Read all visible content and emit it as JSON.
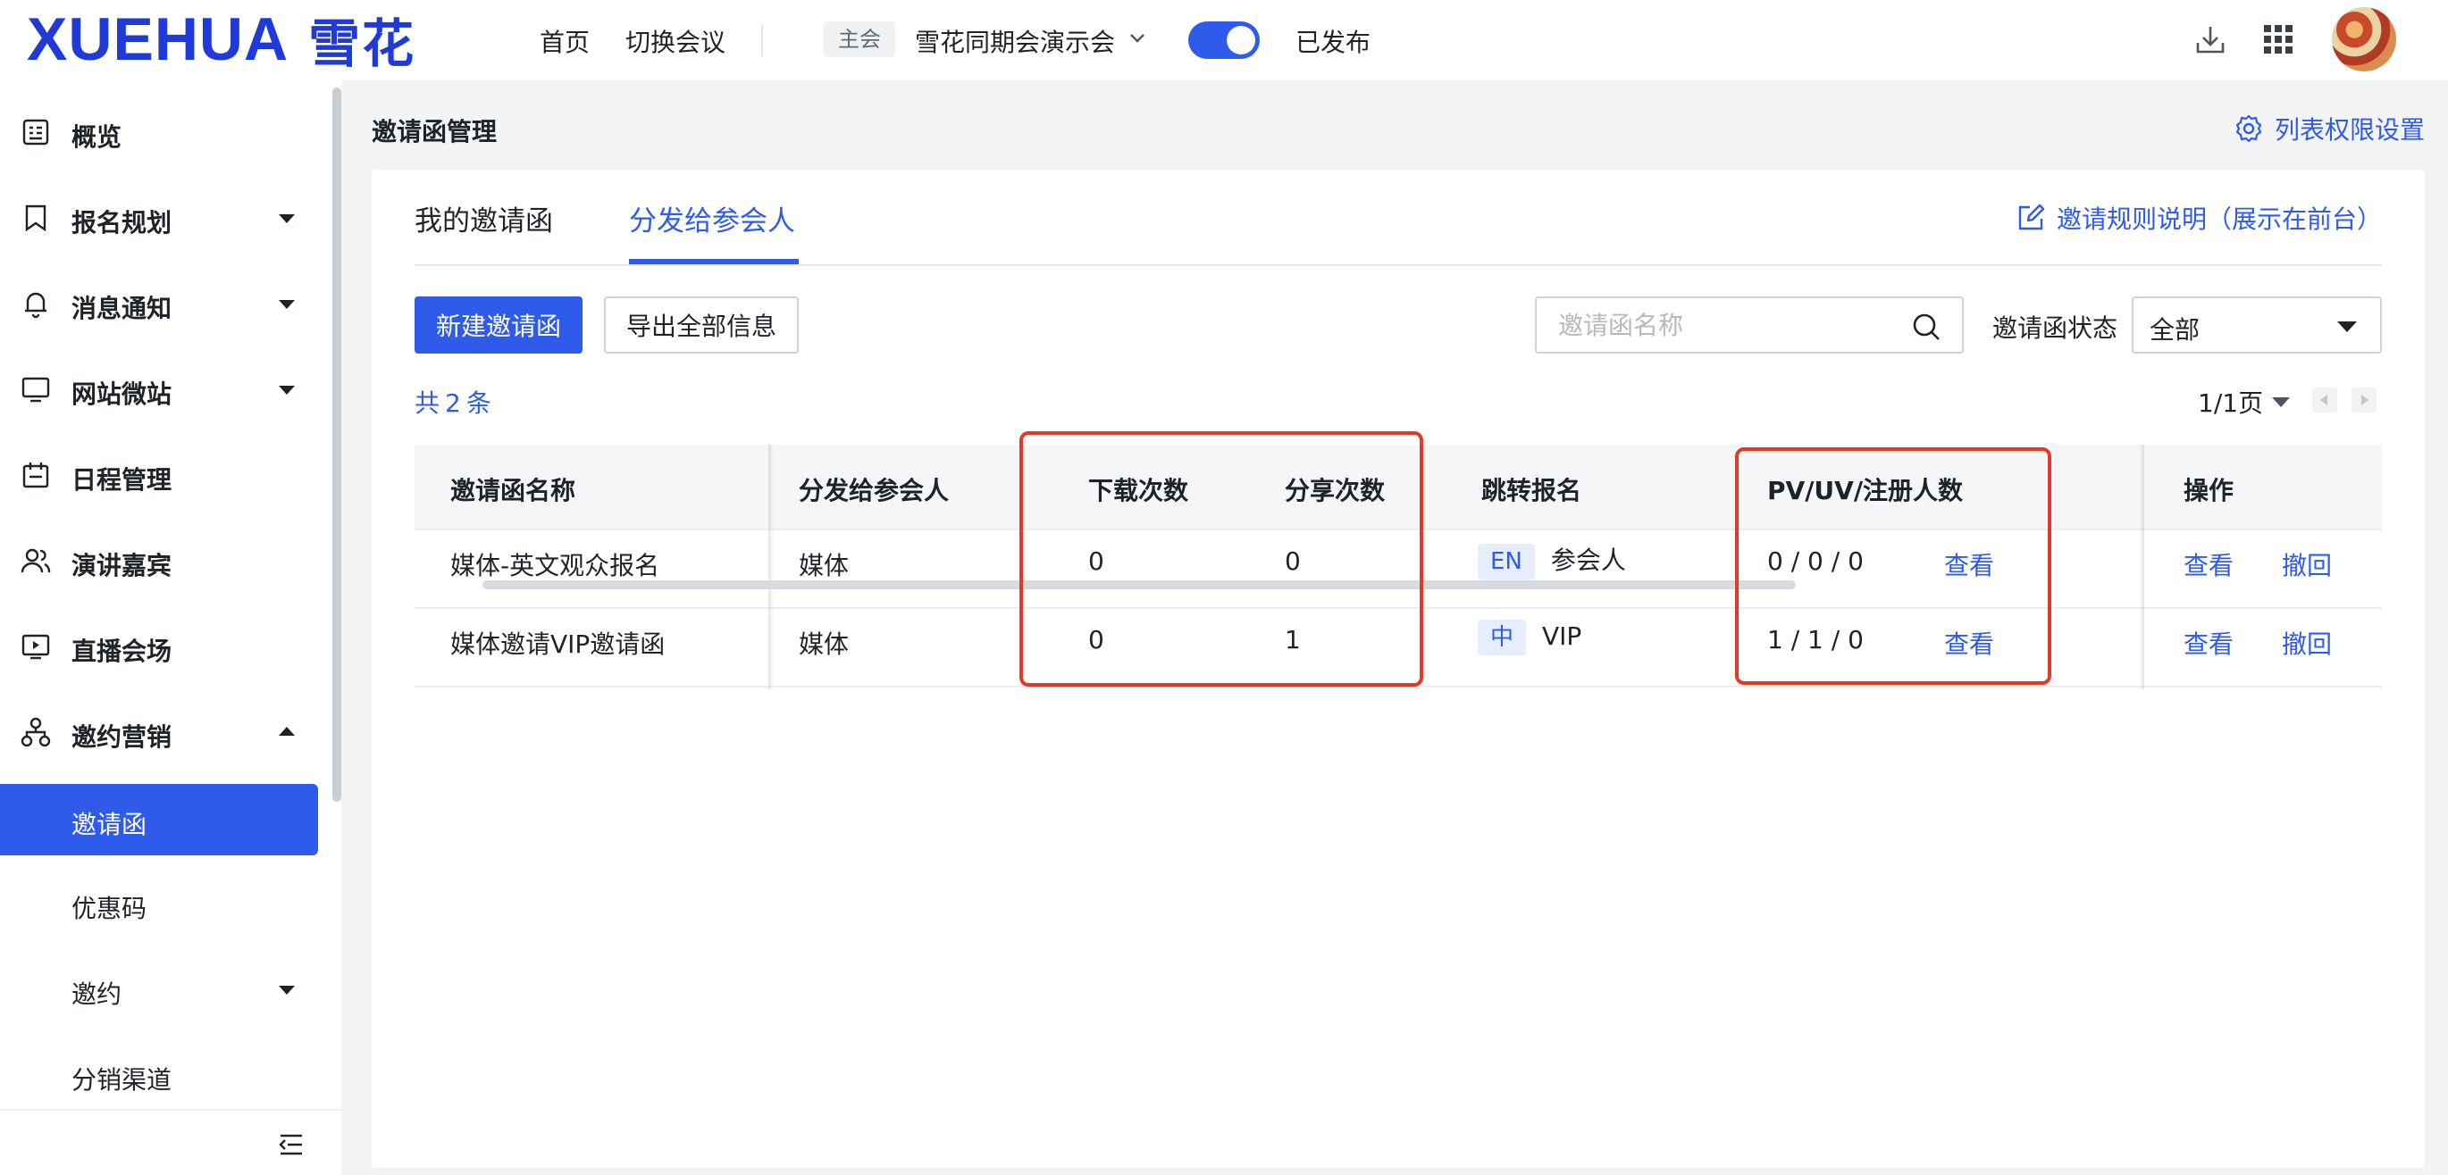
{
  "header": {
    "logo_en": "XUEHUA",
    "logo_cn": "雪花",
    "nav_home": "首页",
    "nav_switch": "切换会议",
    "main_tag": "主会",
    "event_name": "雪花同期会演示会",
    "toggle_on": true,
    "publish_status": "已发布"
  },
  "sidebar": {
    "items": [
      {
        "label": "概览",
        "icon": "overview-icon",
        "caret": "none"
      },
      {
        "label": "报名规划",
        "icon": "bookmark-icon",
        "caret": "down"
      },
      {
        "label": "消息通知",
        "icon": "bell-icon",
        "caret": "down"
      },
      {
        "label": "网站微站",
        "icon": "monitor-icon",
        "caret": "down"
      },
      {
        "label": "日程管理",
        "icon": "calendar-icon",
        "caret": "none"
      },
      {
        "label": "演讲嘉宾",
        "icon": "users-icon",
        "caret": "none"
      },
      {
        "label": "直播会场",
        "icon": "live-icon",
        "caret": "none"
      },
      {
        "label": "邀约营销",
        "icon": "network-icon",
        "caret": "up"
      }
    ],
    "sub_items": [
      {
        "label": "邀请函",
        "active": true,
        "caret": "none"
      },
      {
        "label": "优惠码",
        "active": false,
        "caret": "none"
      },
      {
        "label": "邀约",
        "active": false,
        "caret": "down"
      },
      {
        "label": "分销渠道",
        "active": false,
        "caret": "none"
      }
    ]
  },
  "main": {
    "page_title": "邀请函管理",
    "perm_link": "列表权限设置",
    "tabs": [
      {
        "label": "我的邀请函",
        "active": false
      },
      {
        "label": "分发给参会人",
        "active": true
      }
    ],
    "rule_link": "邀请规则说明（展示在前台）",
    "btn_new": "新建邀请函",
    "btn_export": "导出全部信息",
    "search_placeholder": "邀请函名称",
    "status_label": "邀请函状态",
    "status_value": "全部",
    "total_prefix": "共",
    "total_count": "2",
    "total_suffix": "条",
    "pager": "1/1页"
  },
  "table": {
    "columns": [
      "邀请函名称",
      "分发给参会人",
      "下载次数",
      "分享次数",
      "跳转报名",
      "PV/UV/注册人数",
      "操作"
    ],
    "rows": [
      {
        "name": "媒体-英文观众报名",
        "target": "媒体",
        "downloads": "0",
        "shares": "0",
        "lang": "EN",
        "redirect": "参会人",
        "pvuv": "0 / 0 / 0",
        "pvuv_action": "查看",
        "op_view": "查看",
        "op_revoke": "撤回"
      },
      {
        "name": "媒体邀请VIP邀请函",
        "target": "媒体",
        "downloads": "0",
        "shares": "1",
        "lang": "中",
        "redirect": "VIP",
        "pvuv": "1 / 1 / 0",
        "pvuv_action": "查看",
        "op_view": "查看",
        "op_revoke": "撤回"
      }
    ]
  },
  "colors": {
    "primary": "#2f5bea",
    "highlight": "#e03a2a"
  }
}
